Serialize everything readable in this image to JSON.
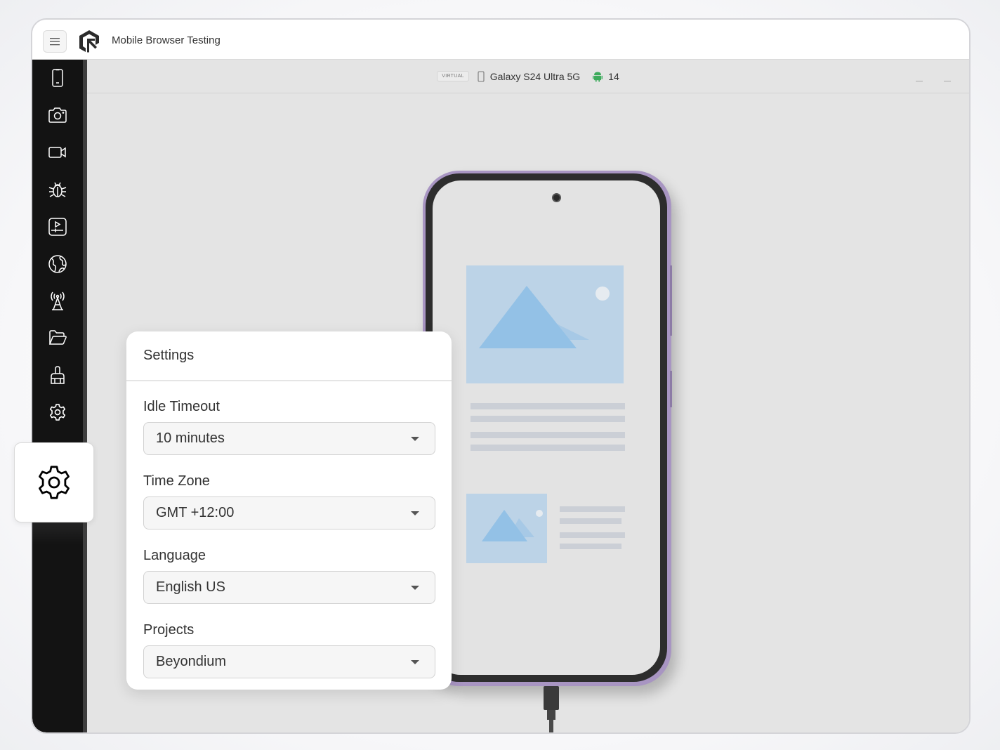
{
  "app": {
    "title": "Mobile Browser Testing",
    "menu_icon": "hamburger-icon",
    "logo_icon": "lambdatest-logo-icon"
  },
  "sidebar": {
    "items": [
      {
        "name": "device",
        "icon": "smartphone-icon"
      },
      {
        "name": "screenshot",
        "icon": "camera-icon"
      },
      {
        "name": "record-video",
        "icon": "video-icon"
      },
      {
        "name": "debug",
        "icon": "bug-icon"
      },
      {
        "name": "app-player",
        "icon": "play-console-icon"
      },
      {
        "name": "geolocation",
        "icon": "globe-icon"
      },
      {
        "name": "network",
        "icon": "antenna-icon"
      },
      {
        "name": "files",
        "icon": "folder-icon"
      },
      {
        "name": "clean",
        "icon": "brush-icon"
      },
      {
        "name": "settings",
        "icon": "gear-icon"
      }
    ]
  },
  "device_bar": {
    "badge": "VIRTUAL",
    "device_icon": "smartphone-icon",
    "device_name": "Galaxy S24 Ultra 5G",
    "os_icon": "android-icon",
    "os_version": "14",
    "os_color": "#3dab5c"
  },
  "phone": {
    "frame_color": "#a895c2"
  },
  "settings": {
    "title": "Settings",
    "fields": [
      {
        "label": "Idle Timeout",
        "value": "10 minutes"
      },
      {
        "label": "Time Zone",
        "value": "GMT +12:00"
      },
      {
        "label": "Language",
        "value": "English US"
      },
      {
        "label": "Projects",
        "value": "Beyondium"
      }
    ]
  },
  "floating_button": {
    "icon": "gear-icon"
  }
}
